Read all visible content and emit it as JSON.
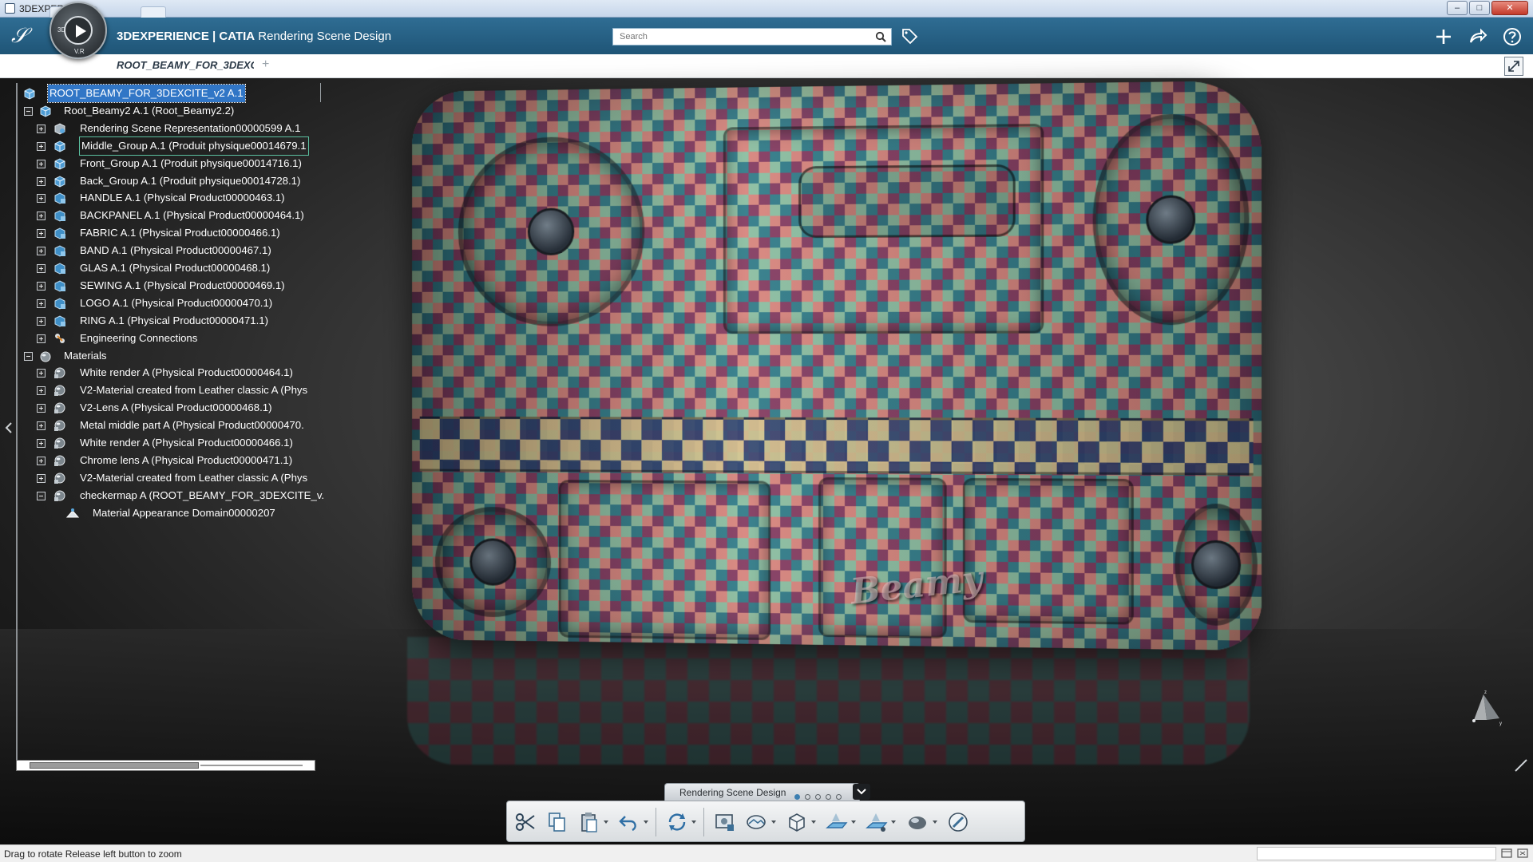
{
  "window": {
    "title": "3DEXPERIENCE",
    "controls": {
      "minimize": "–",
      "maximize": "□",
      "close": "✕"
    }
  },
  "topbar": {
    "brand": "3DEXPERIENCE | CATIA",
    "app_name": " Rendering Scene Design",
    "compass_labels": {
      "top_left": "3D",
      "bottom": "V.R"
    },
    "search_placeholder": "Search",
    "icons": [
      "ds-logo-icon",
      "compass-icon",
      "search-icon",
      "tag-icon",
      "plus-icon",
      "share-icon",
      "help-icon"
    ]
  },
  "tabs": {
    "active": "ROOT_BEAMY_FOR_3DEXC",
    "add": "+"
  },
  "tree": {
    "nodes": [
      {
        "label": "ROOT_BEAMY_FOR_3DEXCITE_v2 A.1",
        "level": 0,
        "expander": "none",
        "icon": "root-product-icon",
        "selected": true
      },
      {
        "label": "Root_Beamy2 A.1 (Root_Beamy2.2)",
        "level": 1,
        "expander": "minus",
        "icon": "product-icon"
      },
      {
        "label": "Rendering Scene Representation00000599 A.1",
        "level": 2,
        "expander": "plus",
        "icon": "scene-icon"
      },
      {
        "label": "Middle_Group A.1 (Produit physique00014679.1",
        "level": 2,
        "expander": "plus",
        "icon": "product-icon",
        "highlight": true
      },
      {
        "label": "Front_Group A.1 (Produit physique00014716.1)",
        "level": 2,
        "expander": "plus",
        "icon": "product-icon"
      },
      {
        "label": "Back_Group A.1 (Produit physique00014728.1)",
        "level": 2,
        "expander": "plus",
        "icon": "product-icon"
      },
      {
        "label": "HANDLE A.1 (Physical Product00000463.1)",
        "level": 2,
        "expander": "plus",
        "icon": "part-icon"
      },
      {
        "label": "BACKPANEL A.1 (Physical Product00000464.1)",
        "level": 2,
        "expander": "plus",
        "icon": "part-icon"
      },
      {
        "label": "FABRIC A.1 (Physical Product00000466.1)",
        "level": 2,
        "expander": "plus",
        "icon": "part-icon"
      },
      {
        "label": "BAND A.1 (Physical Product00000467.1)",
        "level": 2,
        "expander": "plus",
        "icon": "part-icon"
      },
      {
        "label": "GLAS A.1 (Physical Product00000468.1)",
        "level": 2,
        "expander": "plus",
        "icon": "part-icon"
      },
      {
        "label": "SEWING A.1 (Physical Product00000469.1)",
        "level": 2,
        "expander": "plus",
        "icon": "part-icon"
      },
      {
        "label": "LOGO A.1 (Physical Product00000470.1)",
        "level": 2,
        "expander": "plus",
        "icon": "part-icon"
      },
      {
        "label": "RING A.1 (Physical Product00000471.1)",
        "level": 2,
        "expander": "plus",
        "icon": "part-icon"
      },
      {
        "label": "Engineering Connections",
        "level": 2,
        "expander": "plus",
        "icon": "engineering-connections-icon"
      },
      {
        "label": "Materials",
        "level": 1,
        "expander": "minus",
        "icon": "materials-folder-icon"
      },
      {
        "label": "White render A (Physical Product00000464.1)",
        "level": 2,
        "expander": "plus",
        "icon": "material-icon"
      },
      {
        "label": "V2-Material created from Leather classic A (Phys",
        "level": 2,
        "expander": "plus",
        "icon": "material-icon"
      },
      {
        "label": "V2-Lens A (Physical Product00000468.1)",
        "level": 2,
        "expander": "plus",
        "icon": "material-icon"
      },
      {
        "label": "Metal middle part A (Physical Product00000470.",
        "level": 2,
        "expander": "plus",
        "icon": "material-icon"
      },
      {
        "label": "White render A (Physical Product00000466.1)",
        "level": 2,
        "expander": "plus",
        "icon": "material-icon"
      },
      {
        "label": "Chrome lens A (Physical Product00000471.1)",
        "level": 2,
        "expander": "plus",
        "icon": "material-icon"
      },
      {
        "label": "V2-Material created from Leather classic A (Phys",
        "level": 2,
        "expander": "plus",
        "icon": "material-icon"
      },
      {
        "label": "checkermap A (ROOT_BEAMY_FOR_3DEXCITE_v.",
        "level": 2,
        "expander": "minus",
        "icon": "material-icon"
      },
      {
        "label": "Material Appearance Domain00000207",
        "level": 3,
        "expander": "none",
        "icon": "appearance-domain-icon"
      }
    ]
  },
  "viewport": {
    "product_logo": "Beamy"
  },
  "action_bar": {
    "section_label": "Rendering Scene Design",
    "page_dots": 5,
    "active_dot": 0,
    "tools": [
      {
        "name": "cut-icon",
        "dropdown": false
      },
      {
        "name": "copy-icon",
        "dropdown": false
      },
      {
        "name": "paste-icon",
        "dropdown": true
      },
      {
        "name": "undo-icon",
        "dropdown": true
      },
      {
        "name": "update-icon",
        "dropdown": true
      },
      {
        "name": "render-settings-icon",
        "dropdown": false
      },
      {
        "name": "environment-icon",
        "dropdown": true
      },
      {
        "name": "bounding-box-icon",
        "dropdown": true
      },
      {
        "name": "floor-icon",
        "dropdown": true
      },
      {
        "name": "light-icon",
        "dropdown": true
      },
      {
        "name": "material-sphere-icon",
        "dropdown": true
      },
      {
        "name": "camera-lens-icon",
        "dropdown": false
      }
    ]
  },
  "statusbar": {
    "message": "Drag to rotate  Release left button to zoom"
  },
  "colors": {
    "topbar": "#2a6389",
    "selection": "#3176c6",
    "checker_red": "#c83b5f",
    "checker_teal": "#3aa7a2",
    "checker_cream": "#e8d8a0",
    "checker_navy": "#253e65"
  }
}
